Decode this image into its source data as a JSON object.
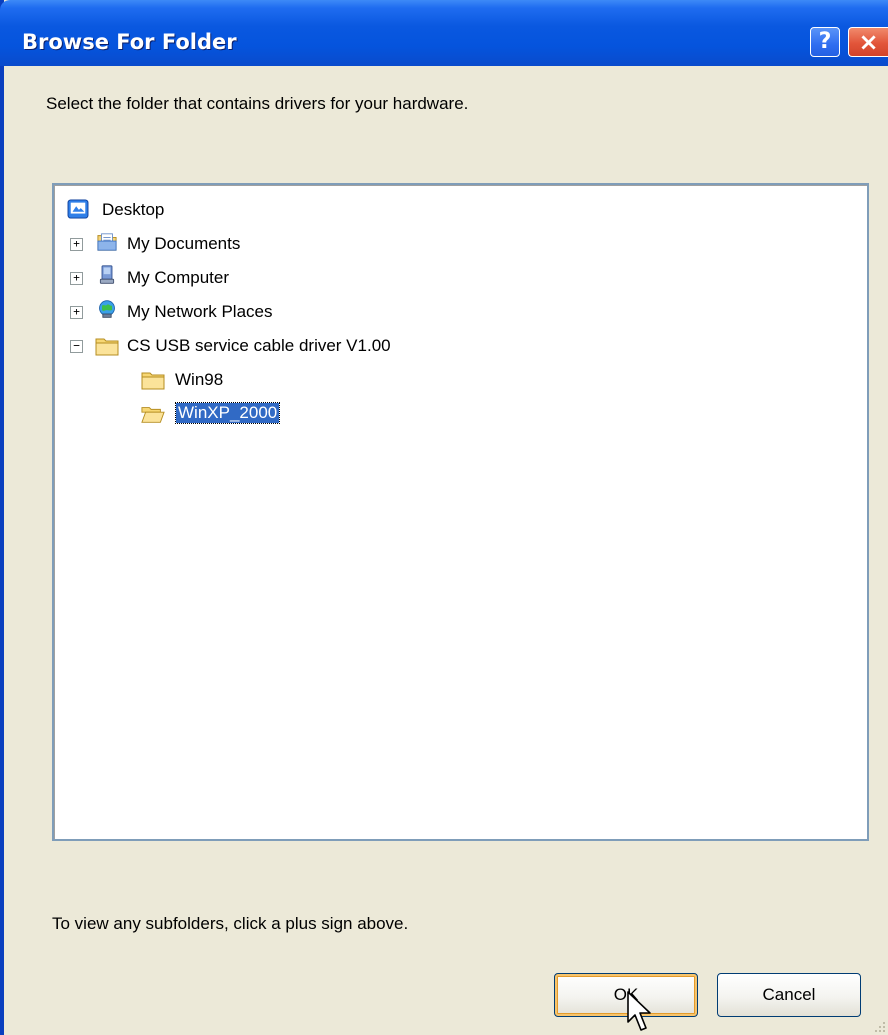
{
  "window": {
    "title": "Browse For Folder",
    "help_button": "?",
    "close_button": "×"
  },
  "instruction": "Select the folder that contains drivers for your hardware.",
  "tree": {
    "items": [
      {
        "label": "Desktop",
        "icon": "desktop-icon",
        "expander": ""
      },
      {
        "label": "My Documents",
        "icon": "my-documents-icon",
        "expander": "+"
      },
      {
        "label": "My Computer",
        "icon": "my-computer-icon",
        "expander": "+"
      },
      {
        "label": "My Network Places",
        "icon": "network-places-icon",
        "expander": "+"
      },
      {
        "label": "CS USB service cable driver V1.00",
        "icon": "folder-icon",
        "expander": "−"
      },
      {
        "label": "Win98",
        "icon": "folder-icon",
        "expander": ""
      },
      {
        "label": "WinXP_2000",
        "icon": "folder-open-icon",
        "expander": "",
        "selected": true
      }
    ]
  },
  "hint": "To view any subfolders, click a plus sign above.",
  "buttons": {
    "ok": "OK",
    "cancel": "Cancel"
  },
  "colors": {
    "titlebar": "#0554dd",
    "selection": "#316ac5",
    "dialog_bg": "#ece9d8"
  }
}
